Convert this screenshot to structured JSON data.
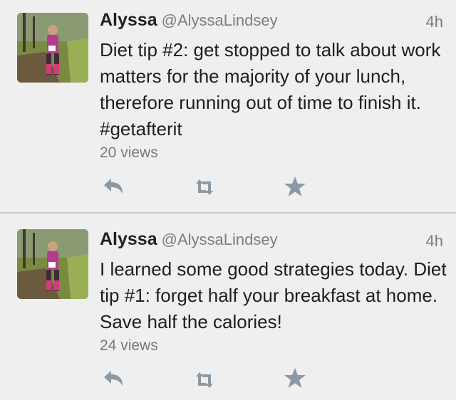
{
  "tweets": [
    {
      "name": "Alyssa",
      "handle": "@AlyssaLindsey",
      "time": "4h",
      "text": "Diet tip #2: get stopped to talk about work matters for the majority of your lunch, therefore running out of time to finish it. #getafterit",
      "views": "20 views"
    },
    {
      "name": "Alyssa",
      "handle": "@AlyssaLindsey",
      "time": "4h",
      "text": "I learned some good strategies today. Diet tip #1: forget half your breakfast at home. Save half the calories!",
      "views": "24 views"
    }
  ],
  "icons": {
    "reply": "reply-arrow-icon",
    "retweet": "retweet-icon",
    "favorite": "star-icon"
  },
  "colors": {
    "background": "#efefef",
    "action_icon": "#8c99a5",
    "secondary_text": "#7d7d7d"
  }
}
